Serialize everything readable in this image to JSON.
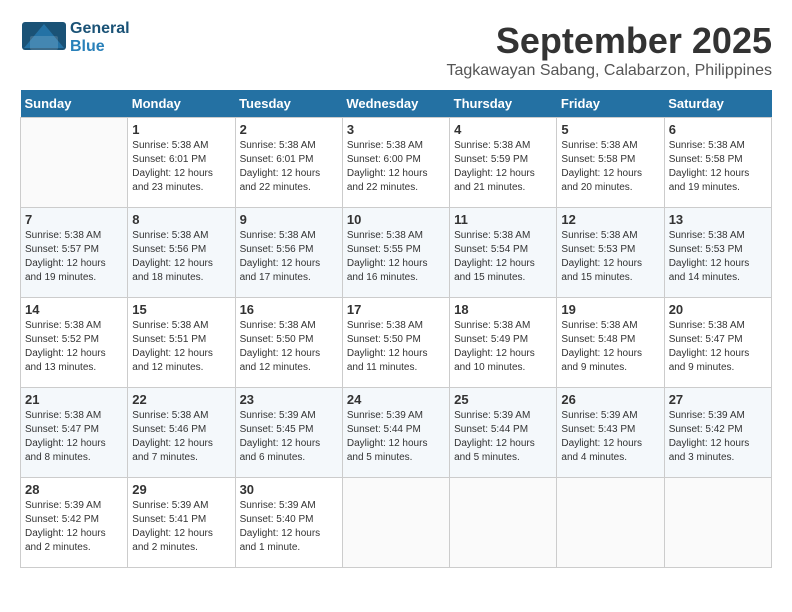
{
  "header": {
    "title": "September 2025",
    "subtitle": "Tagkawayan Sabang, Calabarzon, Philippines",
    "logo_text": "General",
    "logo_blue": "Blue"
  },
  "columns": [
    "Sunday",
    "Monday",
    "Tuesday",
    "Wednesday",
    "Thursday",
    "Friday",
    "Saturday"
  ],
  "weeks": [
    [
      {
        "day": "",
        "info": ""
      },
      {
        "day": "1",
        "info": "Sunrise: 5:38 AM\nSunset: 6:01 PM\nDaylight: 12 hours\nand 23 minutes."
      },
      {
        "day": "2",
        "info": "Sunrise: 5:38 AM\nSunset: 6:01 PM\nDaylight: 12 hours\nand 22 minutes."
      },
      {
        "day": "3",
        "info": "Sunrise: 5:38 AM\nSunset: 6:00 PM\nDaylight: 12 hours\nand 22 minutes."
      },
      {
        "day": "4",
        "info": "Sunrise: 5:38 AM\nSunset: 5:59 PM\nDaylight: 12 hours\nand 21 minutes."
      },
      {
        "day": "5",
        "info": "Sunrise: 5:38 AM\nSunset: 5:58 PM\nDaylight: 12 hours\nand 20 minutes."
      },
      {
        "day": "6",
        "info": "Sunrise: 5:38 AM\nSunset: 5:58 PM\nDaylight: 12 hours\nand 19 minutes."
      }
    ],
    [
      {
        "day": "7",
        "info": "Sunrise: 5:38 AM\nSunset: 5:57 PM\nDaylight: 12 hours\nand 19 minutes."
      },
      {
        "day": "8",
        "info": "Sunrise: 5:38 AM\nSunset: 5:56 PM\nDaylight: 12 hours\nand 18 minutes."
      },
      {
        "day": "9",
        "info": "Sunrise: 5:38 AM\nSunset: 5:56 PM\nDaylight: 12 hours\nand 17 minutes."
      },
      {
        "day": "10",
        "info": "Sunrise: 5:38 AM\nSunset: 5:55 PM\nDaylight: 12 hours\nand 16 minutes."
      },
      {
        "day": "11",
        "info": "Sunrise: 5:38 AM\nSunset: 5:54 PM\nDaylight: 12 hours\nand 15 minutes."
      },
      {
        "day": "12",
        "info": "Sunrise: 5:38 AM\nSunset: 5:53 PM\nDaylight: 12 hours\nand 15 minutes."
      },
      {
        "day": "13",
        "info": "Sunrise: 5:38 AM\nSunset: 5:53 PM\nDaylight: 12 hours\nand 14 minutes."
      }
    ],
    [
      {
        "day": "14",
        "info": "Sunrise: 5:38 AM\nSunset: 5:52 PM\nDaylight: 12 hours\nand 13 minutes."
      },
      {
        "day": "15",
        "info": "Sunrise: 5:38 AM\nSunset: 5:51 PM\nDaylight: 12 hours\nand 12 minutes."
      },
      {
        "day": "16",
        "info": "Sunrise: 5:38 AM\nSunset: 5:50 PM\nDaylight: 12 hours\nand 12 minutes."
      },
      {
        "day": "17",
        "info": "Sunrise: 5:38 AM\nSunset: 5:50 PM\nDaylight: 12 hours\nand 11 minutes."
      },
      {
        "day": "18",
        "info": "Sunrise: 5:38 AM\nSunset: 5:49 PM\nDaylight: 12 hours\nand 10 minutes."
      },
      {
        "day": "19",
        "info": "Sunrise: 5:38 AM\nSunset: 5:48 PM\nDaylight: 12 hours\nand 9 minutes."
      },
      {
        "day": "20",
        "info": "Sunrise: 5:38 AM\nSunset: 5:47 PM\nDaylight: 12 hours\nand 9 minutes."
      }
    ],
    [
      {
        "day": "21",
        "info": "Sunrise: 5:38 AM\nSunset: 5:47 PM\nDaylight: 12 hours\nand 8 minutes."
      },
      {
        "day": "22",
        "info": "Sunrise: 5:38 AM\nSunset: 5:46 PM\nDaylight: 12 hours\nand 7 minutes."
      },
      {
        "day": "23",
        "info": "Sunrise: 5:39 AM\nSunset: 5:45 PM\nDaylight: 12 hours\nand 6 minutes."
      },
      {
        "day": "24",
        "info": "Sunrise: 5:39 AM\nSunset: 5:44 PM\nDaylight: 12 hours\nand 5 minutes."
      },
      {
        "day": "25",
        "info": "Sunrise: 5:39 AM\nSunset: 5:44 PM\nDaylight: 12 hours\nand 5 minutes."
      },
      {
        "day": "26",
        "info": "Sunrise: 5:39 AM\nSunset: 5:43 PM\nDaylight: 12 hours\nand 4 minutes."
      },
      {
        "day": "27",
        "info": "Sunrise: 5:39 AM\nSunset: 5:42 PM\nDaylight: 12 hours\nand 3 minutes."
      }
    ],
    [
      {
        "day": "28",
        "info": "Sunrise: 5:39 AM\nSunset: 5:42 PM\nDaylight: 12 hours\nand 2 minutes."
      },
      {
        "day": "29",
        "info": "Sunrise: 5:39 AM\nSunset: 5:41 PM\nDaylight: 12 hours\nand 2 minutes."
      },
      {
        "day": "30",
        "info": "Sunrise: 5:39 AM\nSunset: 5:40 PM\nDaylight: 12 hours\nand 1 minute."
      },
      {
        "day": "",
        "info": ""
      },
      {
        "day": "",
        "info": ""
      },
      {
        "day": "",
        "info": ""
      },
      {
        "day": "",
        "info": ""
      }
    ]
  ]
}
